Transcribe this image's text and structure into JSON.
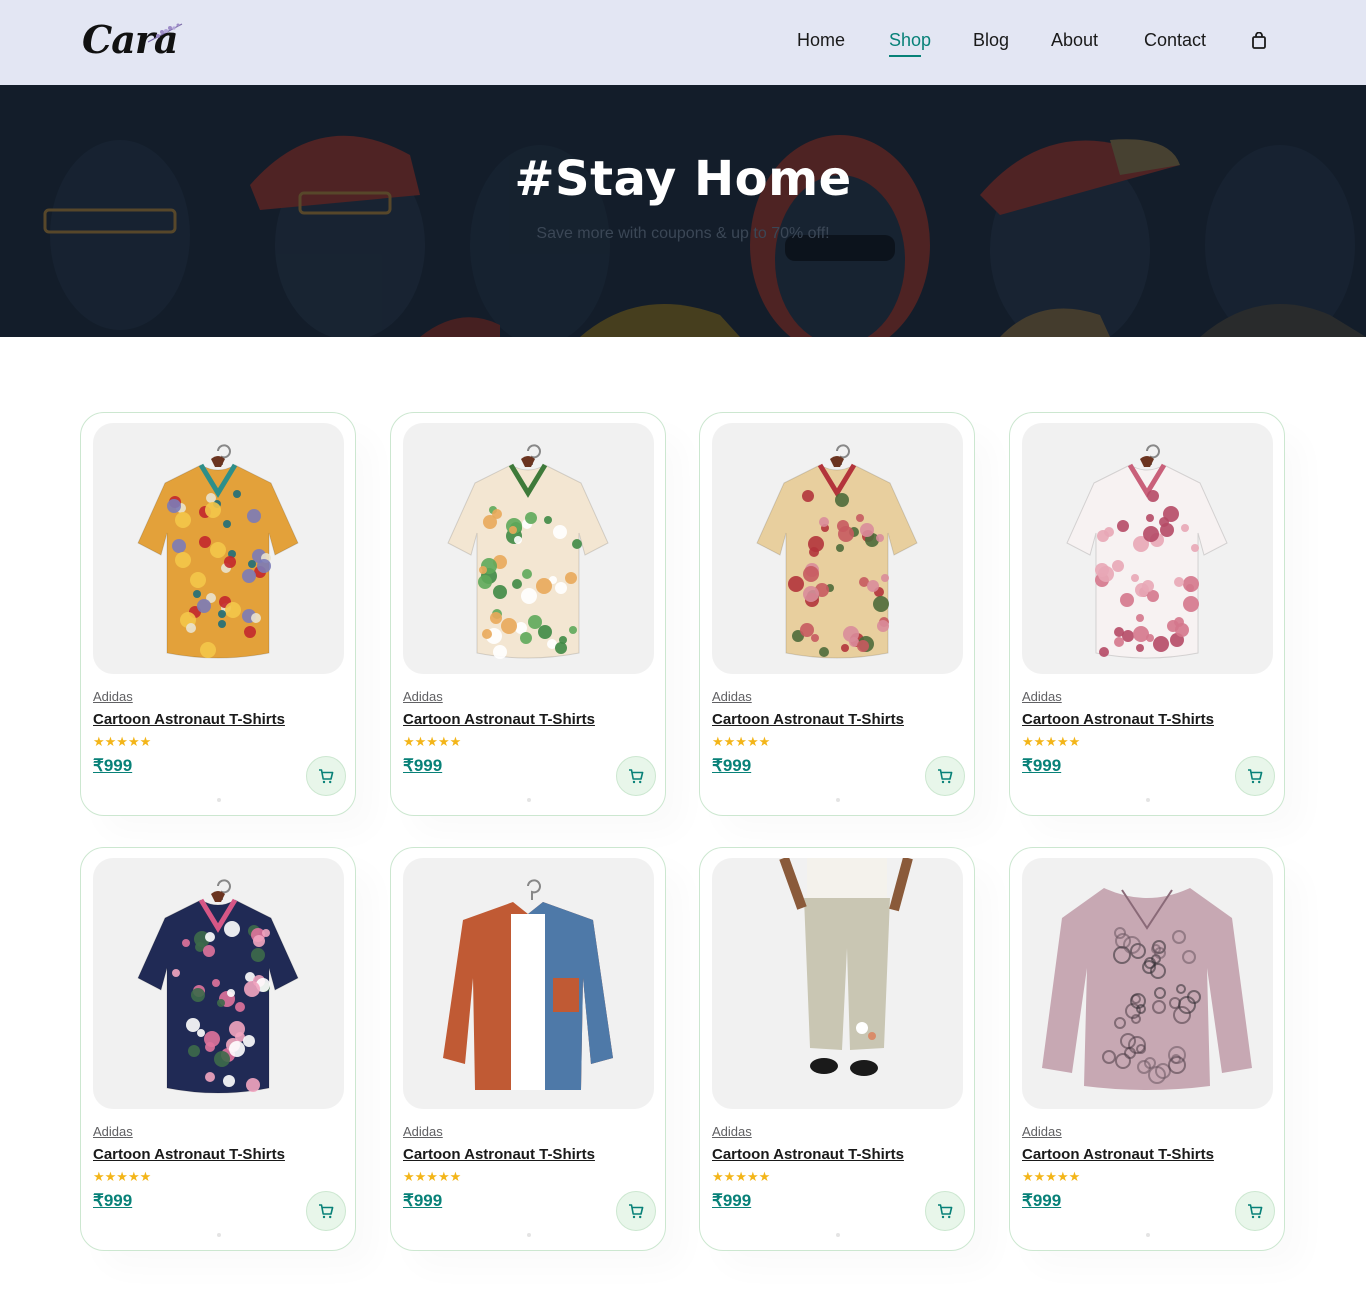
{
  "header": {
    "logo": "Cara",
    "nav": [
      {
        "label": "Home",
        "active": false
      },
      {
        "label": "Shop",
        "active": true
      },
      {
        "label": "Blog",
        "active": false
      },
      {
        "label": "About",
        "active": false
      },
      {
        "label": "Contact",
        "active": false
      }
    ],
    "cart_icon": "shopping-bag-icon",
    "accent_color": "#088178",
    "background": "#e3e6f3"
  },
  "banner": {
    "title": "#Stay Home",
    "subtitle": "Save more with coupons & up to 70% off!"
  },
  "products": [
    {
      "brand": "Adidas",
      "name": "Cartoon Astronaut T-Shirts",
      "rating": 5,
      "price": "₹999",
      "image": "abstract-print-shirt"
    },
    {
      "brand": "Adidas",
      "name": "Cartoon Astronaut T-Shirts",
      "rating": 5,
      "price": "₹999",
      "image": "lily-print-shirt"
    },
    {
      "brand": "Adidas",
      "name": "Cartoon Astronaut T-Shirts",
      "rating": 5,
      "price": "₹999",
      "image": "floral-shirt"
    },
    {
      "brand": "Adidas",
      "name": "Cartoon Astronaut T-Shirts",
      "rating": 5,
      "price": "₹999",
      "image": "white-blossom-shirt"
    },
    {
      "brand": "Adidas",
      "name": "Cartoon Astronaut T-Shirts",
      "rating": 5,
      "price": "₹999",
      "image": "navy-rose-shirt"
    },
    {
      "brand": "Adidas",
      "name": "Cartoon Astronaut T-Shirts",
      "rating": 5,
      "price": "₹999",
      "image": "colorblock-jacket"
    },
    {
      "brand": "Adidas",
      "name": "Cartoon Astronaut T-Shirts",
      "rating": 5,
      "price": "₹999",
      "image": "linen-trousers"
    },
    {
      "brand": "Adidas",
      "name": "Cartoon Astronaut T-Shirts",
      "rating": 5,
      "price": "₹999",
      "image": "cat-print-blouse"
    }
  ],
  "card_cart_icon": "cart-icon",
  "star_icon": "star-icon",
  "star_color": "#f3b519"
}
